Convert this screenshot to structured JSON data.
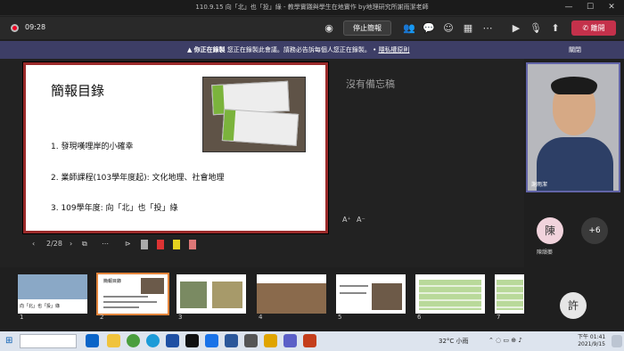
{
  "window": {
    "title": "110.9.15 向「北」也「投」綠 - 教學實踐與學生在地實作 by地理研究所謝雨潔老師"
  },
  "toolbar": {
    "timer": "09:28",
    "stop_presenting": "停止簡報",
    "leave": "離開"
  },
  "banner": {
    "notice": "你正在錄製",
    "message": "您正在錄製此會議。請務必告訴每個人您正在錄製。",
    "privacy": "隱私權原則",
    "dismiss": "關閉"
  },
  "slide": {
    "heading": "簡報目錄",
    "items": [
      "1.  發現嘆哩岸的小確幸",
      "2.  業師課程(103學年度起): 文化地理、社會地理",
      "3.  109學年度: 向「北」也「投」綠"
    ]
  },
  "notes": {
    "placeholder": "沒有備忘稿"
  },
  "font_controls": {
    "increase": "A⁺",
    "decrease": "A⁻"
  },
  "slide_nav": {
    "counter": "2/28"
  },
  "thumbnails": [
    "1",
    "2",
    "3",
    "4",
    "5",
    "6",
    "7"
  ],
  "thumbnail_1_caption": "向「北」也「投」綠",
  "thumbnail_2_title": "簡報目錄",
  "participants": {
    "presenter_name": "謝雨潔",
    "avatar_initial": "陳",
    "avatar_name": "陳韻蓁",
    "overflow": "+6",
    "bottom_initial": "許"
  },
  "taskbar": {
    "weather": "32°C 小雨",
    "time": "下午 01:41",
    "date": "2021/9/15"
  }
}
